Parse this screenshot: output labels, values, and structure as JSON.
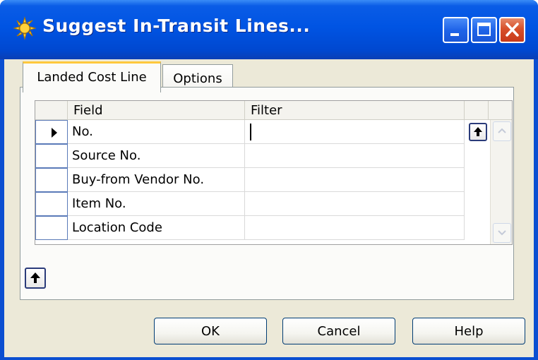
{
  "window": {
    "title": "Suggest In-Transit Lines...",
    "controls": {
      "minimize_icon": "minimize-icon",
      "maximize_icon": "maximize-icon",
      "close_icon": "close-icon"
    }
  },
  "tabs": [
    {
      "label": "Landed Cost Line",
      "active": true
    },
    {
      "label": "Options",
      "active": false
    }
  ],
  "grid": {
    "columns": [
      "Field",
      "Filter"
    ],
    "rows": [
      {
        "field": "No.",
        "filter": "",
        "current": true
      },
      {
        "field": "Source No.",
        "filter": ""
      },
      {
        "field": "Buy-from Vendor No.",
        "filter": ""
      },
      {
        "field": "Item No.",
        "filter": ""
      },
      {
        "field": "Location Code",
        "filter": ""
      }
    ]
  },
  "buttons": {
    "ok": "OK",
    "cancel": "Cancel",
    "help": "Help"
  },
  "colors": {
    "titlebar": "#0054e3",
    "client": "#ece9d8",
    "tab_highlight": "#ffc83c"
  }
}
